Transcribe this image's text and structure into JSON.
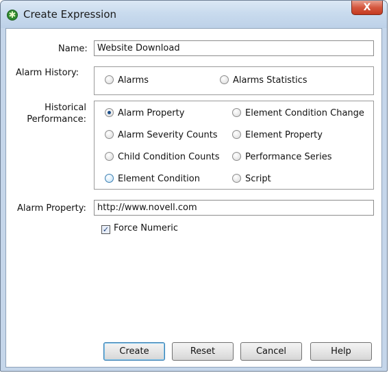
{
  "window": {
    "title": "Create Expression",
    "close_glyph": "X",
    "app_icon": "gear-asterisk-icon"
  },
  "form": {
    "name_label": "Name:",
    "name_value": "Website Download",
    "alarm_history_label": "Alarm History:",
    "alarm_history_options": [
      {
        "label": "Alarms",
        "checked": false
      },
      {
        "label": "Alarms Statistics",
        "checked": false
      }
    ],
    "historical_label_1": "Historical",
    "historical_label_2": "Performance:",
    "historical_options": [
      {
        "label": "Alarm Property",
        "checked": true
      },
      {
        "label": "Element Condition Change",
        "checked": false
      },
      {
        "label": "Alarm Severity Counts",
        "checked": false
      },
      {
        "label": "Element Property",
        "checked": false
      },
      {
        "label": "Child Condition Counts",
        "checked": false
      },
      {
        "label": "Performance Series",
        "checked": false
      },
      {
        "label": "Element Condition",
        "checked": false
      },
      {
        "label": "Script",
        "checked": false
      }
    ],
    "alarm_property_label": "Alarm Property:",
    "alarm_property_value": "http://www.novell.com",
    "force_numeric_label": "Force Numeric",
    "force_numeric_checked": true
  },
  "buttons": {
    "create": "Create",
    "reset": "Reset",
    "cancel": "Cancel",
    "help": "Help"
  }
}
